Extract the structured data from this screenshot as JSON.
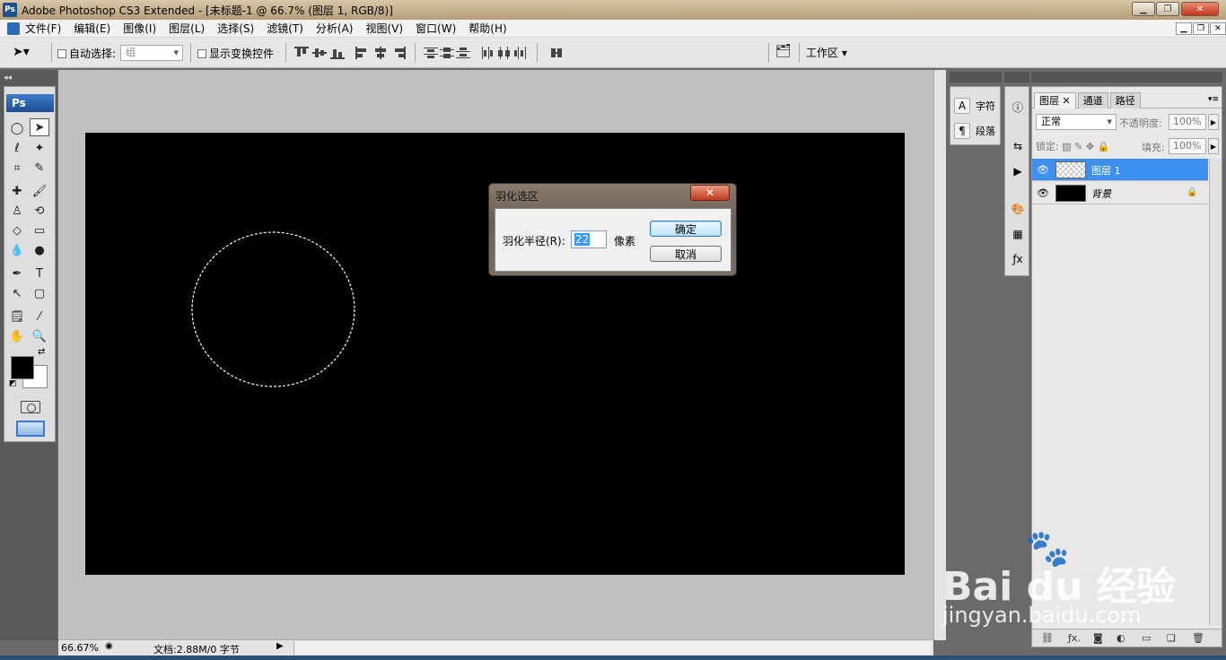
{
  "window": {
    "title": "Adobe Photoshop CS3 Extended - [未标题-1 @ 66.7% (图层 1, RGB/8)]",
    "app_icon_label": "Ps"
  },
  "menu": [
    "文件(F)",
    "编辑(E)",
    "图像(I)",
    "图层(L)",
    "选择(S)",
    "滤镜(T)",
    "分析(A)",
    "视图(V)",
    "窗口(W)",
    "帮助(H)"
  ],
  "options": {
    "auto_select_label": "自动选择:",
    "auto_select_value": "组",
    "show_transform_label": "显示变换控件",
    "workspace_label": "工作区 ▾"
  },
  "toolbox": {
    "logo": "Ps"
  },
  "side_panel": {
    "character_label": "字符",
    "paragraph_label": "段落"
  },
  "layers": {
    "tabs": [
      "图层",
      "通道",
      "路径"
    ],
    "blend_mode": "正常",
    "opacity_label": "不透明度:",
    "opacity_value": "100%",
    "lock_label": "锁定:",
    "fill_label": "填充:",
    "fill_value": "100%",
    "items": [
      {
        "name": "图层 1",
        "selected": true
      },
      {
        "name": "背景",
        "selected": false
      }
    ]
  },
  "dialog": {
    "title": "羽化选区",
    "radius_label": "羽化半径(R):",
    "radius_value": "22",
    "unit": "像素",
    "ok_label": "确定",
    "cancel_label": "取消"
  },
  "status": {
    "zoom": "66.67%",
    "doc_info": "文档:2.88M/0 字节"
  },
  "watermark": {
    "brand": "Bai du 经验",
    "url": "jingyan.baidu.com"
  },
  "colors": {
    "foreground": "#000000",
    "background": "#ffffff",
    "selection_highlight": "#3d8ff0"
  }
}
